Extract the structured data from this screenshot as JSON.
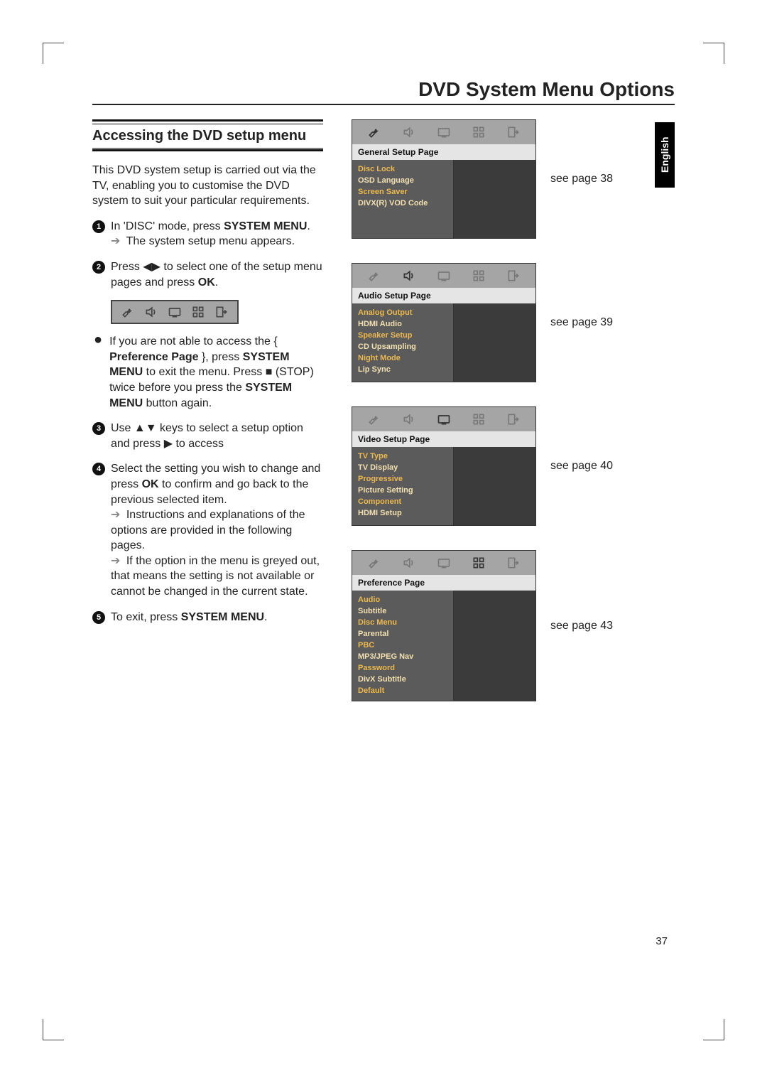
{
  "page_title": "DVD System Menu Options",
  "language_tab": "English",
  "page_number": "37",
  "section_heading": "Accessing the DVD setup menu",
  "intro": "This DVD system setup is carried out via the TV, enabling you to customise the DVD system to suit your particular requirements.",
  "step1": "In 'DISC' mode, press SYSTEM MENU.",
  "step1_sub": "The system setup menu appears.",
  "step2": "Press ◀▶ to select one of the setup menu pages and press OK.",
  "bullet_text": "If you are not able to access the { Preference Page }, press SYSTEM MENU to exit the menu.  Press ■ (STOP) twice before you press the SYSTEM MENU button again.",
  "step3": "Use ▲▼ keys to select a setup option and press ▶ to access",
  "step4": "Select the setting you wish to change and press OK to confirm and go back to the previous selected item.",
  "step4_sub1": "Instructions and explanations of the options are provided in the following pages.",
  "step4_sub2": "If the option in the menu is greyed out, that means the setting is not available or cannot be changed in the current state.",
  "step5": "To exit, press SYSTEM MENU.",
  "menus": [
    {
      "title": "General Setup Page",
      "items": [
        "Disc Lock",
        "OSD Language",
        "Screen Saver",
        "DIVX(R) VOD Code"
      ],
      "see_page": "see page 38",
      "active_tab": 0,
      "tall": false
    },
    {
      "title": "Audio Setup Page",
      "items": [
        "Analog Output",
        "HDMI Audio",
        "Speaker Setup",
        "CD Upsampling",
        "Night Mode",
        "Lip Sync"
      ],
      "see_page": "see page 39",
      "active_tab": 1,
      "tall": false
    },
    {
      "title": "Video Setup Page",
      "items": [
        "TV Type",
        "TV Display",
        "Progressive",
        "Picture Setting",
        "Component",
        "HDMI Setup"
      ],
      "see_page": "see page 40",
      "active_tab": 2,
      "tall": false
    },
    {
      "title": "Preference Page",
      "items": [
        "Audio",
        "Subtitle",
        "Disc Menu",
        "Parental",
        "PBC",
        "MP3/JPEG Nav",
        "Password",
        "DivX Subtitle",
        "Default"
      ],
      "see_page": "see page 43",
      "active_tab": 3,
      "tall": true
    }
  ]
}
